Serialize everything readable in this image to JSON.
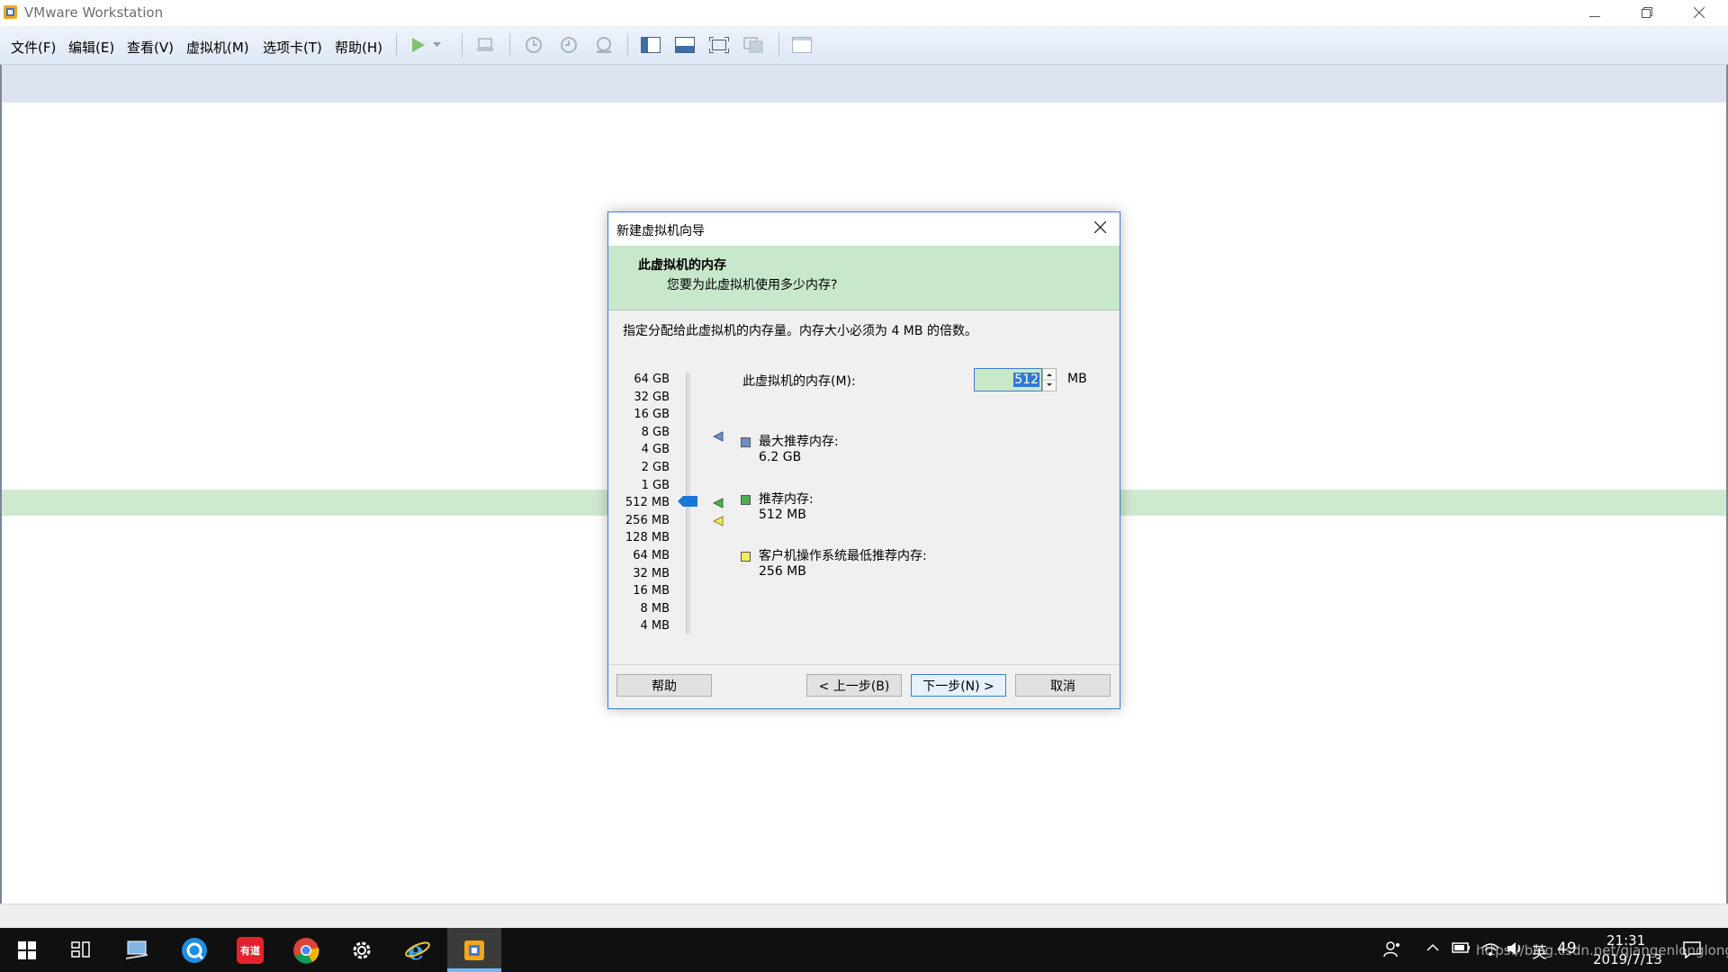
{
  "window": {
    "title": "VMware Workstation",
    "minimize_icon": "minimize-icon",
    "restore_icon": "restore-icon",
    "close_icon": "close-icon"
  },
  "menu": {
    "items": [
      "文件(F)",
      "编辑(E)",
      "查看(V)",
      "虚拟机(M)",
      "选项卡(T)",
      "帮助(H)"
    ]
  },
  "toolbar": {
    "icons": [
      "play-icon",
      "dropdown-arrow-icon",
      "send-keys-icon",
      "snapshot-icon",
      "revert-snapshot-icon",
      "snapshot-manager-icon",
      "library-view-icon",
      "console-view-icon",
      "fullscreen-icon",
      "unity-icon",
      "thumbnail-icon"
    ]
  },
  "dialog": {
    "title": "新建虚拟机向导",
    "header_title": "此虚拟机的内存",
    "header_subtitle": "您要为此虚拟机使用多少内存?",
    "description": "指定分配给此虚拟机的内存量。内存大小必须为 4 MB 的倍数。",
    "scale_labels": [
      "64 GB",
      "32 GB",
      "16 GB",
      "8 GB",
      "4 GB",
      "2 GB",
      "1 GB",
      "512 MB",
      "256 MB",
      "128 MB",
      "64 MB",
      "32 MB",
      "16 MB",
      "8 MB",
      "4 MB"
    ],
    "selected_scale_value": "512 MB",
    "memory_label": "此虚拟机的内存(M):",
    "memory_value": "512",
    "memory_unit": "MB",
    "legend": [
      {
        "label": "最大推荐内存:",
        "value": "6.2 GB",
        "color": "#6b8fc8"
      },
      {
        "label": "推荐内存:",
        "value": "512 MB",
        "color": "#4caf50"
      },
      {
        "label": "客户机操作系统最低推荐内存:",
        "value": "256 MB",
        "color": "#f2ec5a"
      }
    ],
    "buttons": {
      "help": "帮助",
      "back": "< 上一步(B)",
      "next": "下一步(N) >",
      "cancel": "取消"
    }
  },
  "taskbar": {
    "apps": [
      "windows-start-icon",
      "task-view-icon",
      "computer-icon",
      "browser-q-icon",
      "youdao-icon",
      "chrome-icon",
      "settings-icon",
      "ie-icon",
      "vmware-icon"
    ],
    "youdao_label": "有道",
    "tray_lang": "英",
    "tray_number": "49",
    "time": "21:31",
    "date": "2019/7/13",
    "watermark": "https://blog.csdn.net/qiangenlonglong"
  }
}
